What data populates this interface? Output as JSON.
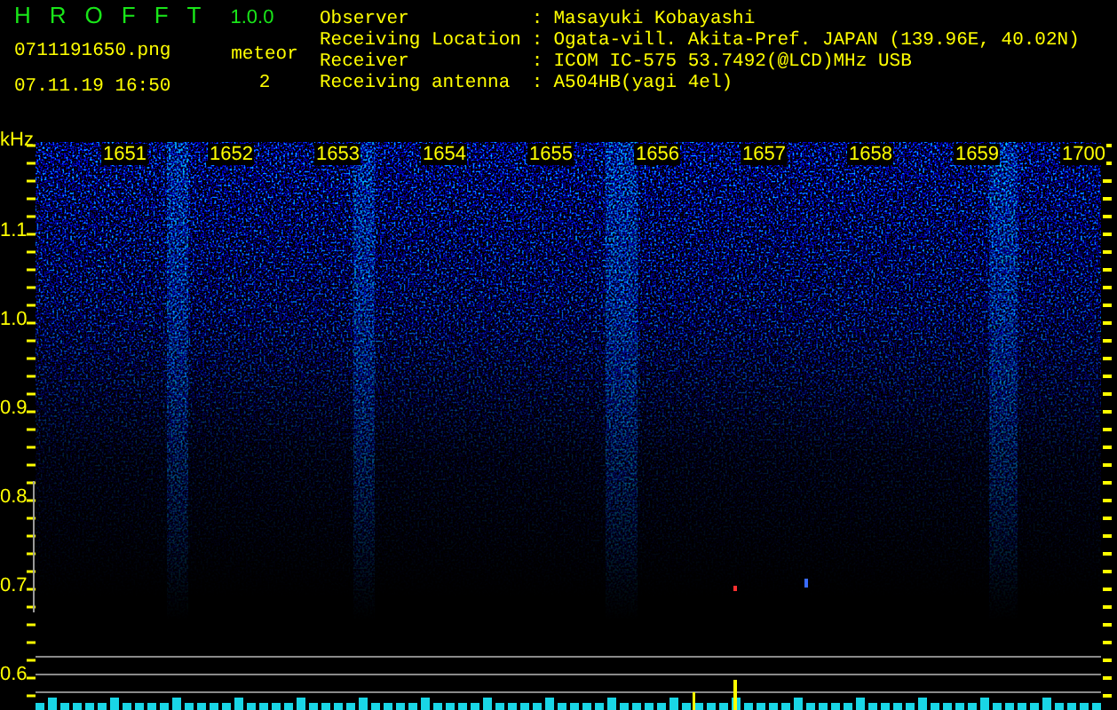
{
  "app": {
    "name": "HROFFT",
    "version": "1.0.0"
  },
  "file": {
    "name": "0711191650.png",
    "timestamp": "07.11.19 16:50"
  },
  "meteor": {
    "label": "meteor",
    "count": "2"
  },
  "info": [
    {
      "label": "Observer",
      "separator": ":",
      "value": "Masayuki Kobayashi"
    },
    {
      "label": "Receiving Location",
      "separator": ":",
      "value": "Ogata-vill. Akita-Pref. JAPAN (139.96E, 40.02N)"
    },
    {
      "label": "Receiver",
      "separator": ":",
      "value": "ICOM IC-575 53.7492(@LCD)MHz USB"
    },
    {
      "label": "Receiving antenna",
      "separator": ":",
      "value": "A504HB(yagi 4el)"
    }
  ],
  "spectrogram": {
    "unit": "kHz",
    "time_labels": [
      "1651",
      "1652",
      "1653",
      "1654",
      "1655",
      "1656",
      "1657",
      "1658",
      "1659",
      "1700"
    ],
    "frequency_labels": [
      "1.1",
      "1.0",
      "0.9",
      "0.8",
      "0.7",
      "0.6"
    ]
  }
}
